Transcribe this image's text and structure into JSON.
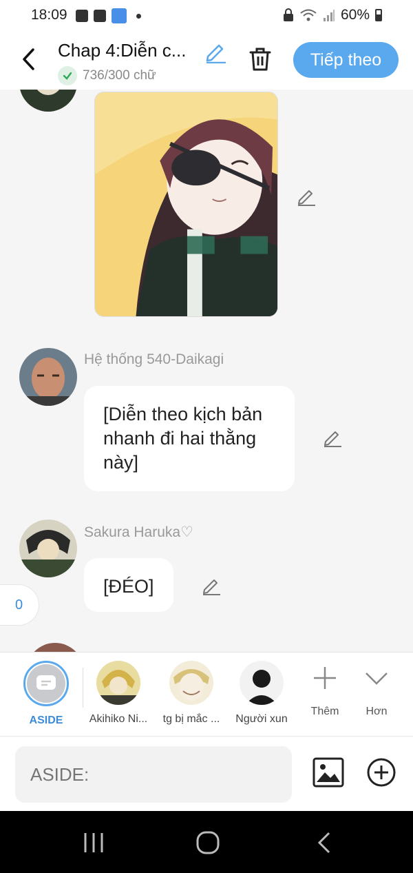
{
  "status_bar": {
    "time": "18:09",
    "battery": "60%"
  },
  "header": {
    "title": "Chap 4:Diễn c...",
    "word_count": "736/300 chữ",
    "next_label": "Tiếp theo"
  },
  "messages": [
    {
      "type": "image",
      "sender": "Sakura Haruka♡"
    },
    {
      "type": "text",
      "sender": "Hệ thống 540-Daikagi",
      "text": "[Diễn theo kịch bản nhanh đi hai thằng này]"
    },
    {
      "type": "text",
      "sender": "Sakura Haruka♡",
      "text": "[ĐÉO]"
    }
  ],
  "aside_count": "0",
  "characters": [
    {
      "label": "ASIDE",
      "selected": true
    },
    {
      "label": "Akihiko Ni..."
    },
    {
      "label": "tg bị mắc ..."
    },
    {
      "label": "Người xun"
    }
  ],
  "tools": {
    "add_label": "Thêm",
    "more_label": "Hơn"
  },
  "input": {
    "placeholder": "ASIDE:"
  },
  "colors": {
    "accent": "#5aa8ee",
    "accent_text": "#3d8bd8",
    "background": "#f5f5f5"
  }
}
